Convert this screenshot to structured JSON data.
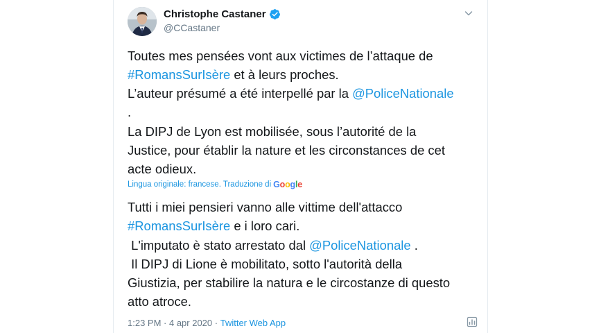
{
  "author": {
    "name": "Christophe Castaner",
    "handle": "@CCastaner"
  },
  "tweet": {
    "line1": "Toutes mes pensées vont aux victimes de l’attaque de",
    "line2_hashtag": "#RomansSurIsère",
    "line2_rest": " et à leurs proches.",
    "line3_text": "L’auteur présumé a été interpellé par la ",
    "line3_mention": "@PoliceNationale",
    "line4": ".",
    "line5": "La DIPJ de Lyon est mobilisée, sous l’autorité de la",
    "line6": "Justice, pour établir la nature et les circonstances de cet",
    "line7": "acte odieux."
  },
  "translation_note": {
    "label": "Lingua originale: francese. Traduzione di",
    "provider": "Google"
  },
  "translation": {
    "line1": "Tutti i miei pensieri vanno alle vittime dell'attacco",
    "line2_hashtag": "#RomansSurIsère",
    "line2_rest": " e i loro cari.",
    "line3_text": " L'imputato è stato arrestato dal ",
    "line3_mention": "@PoliceNationale",
    "line3_end": " .",
    "line4": " Il DIPJ di Lione è mobilitato, sotto l'autorità della",
    "line5": "Giustizia, per stabilire la natura e le circostanze di questo",
    "line6": "atto atroce."
  },
  "footer": {
    "time": "1:23 PM",
    "separator1": " · ",
    "date": "4 apr 2020",
    "separator2": " · ",
    "source": "Twitter Web App"
  },
  "icons": {
    "verified": "verified-badge-icon",
    "menu": "chevron-down-icon",
    "stats": "analytics-icon"
  },
  "colors": {
    "link": "#1b95e0",
    "text": "#14171a",
    "secondary": "#657786"
  }
}
